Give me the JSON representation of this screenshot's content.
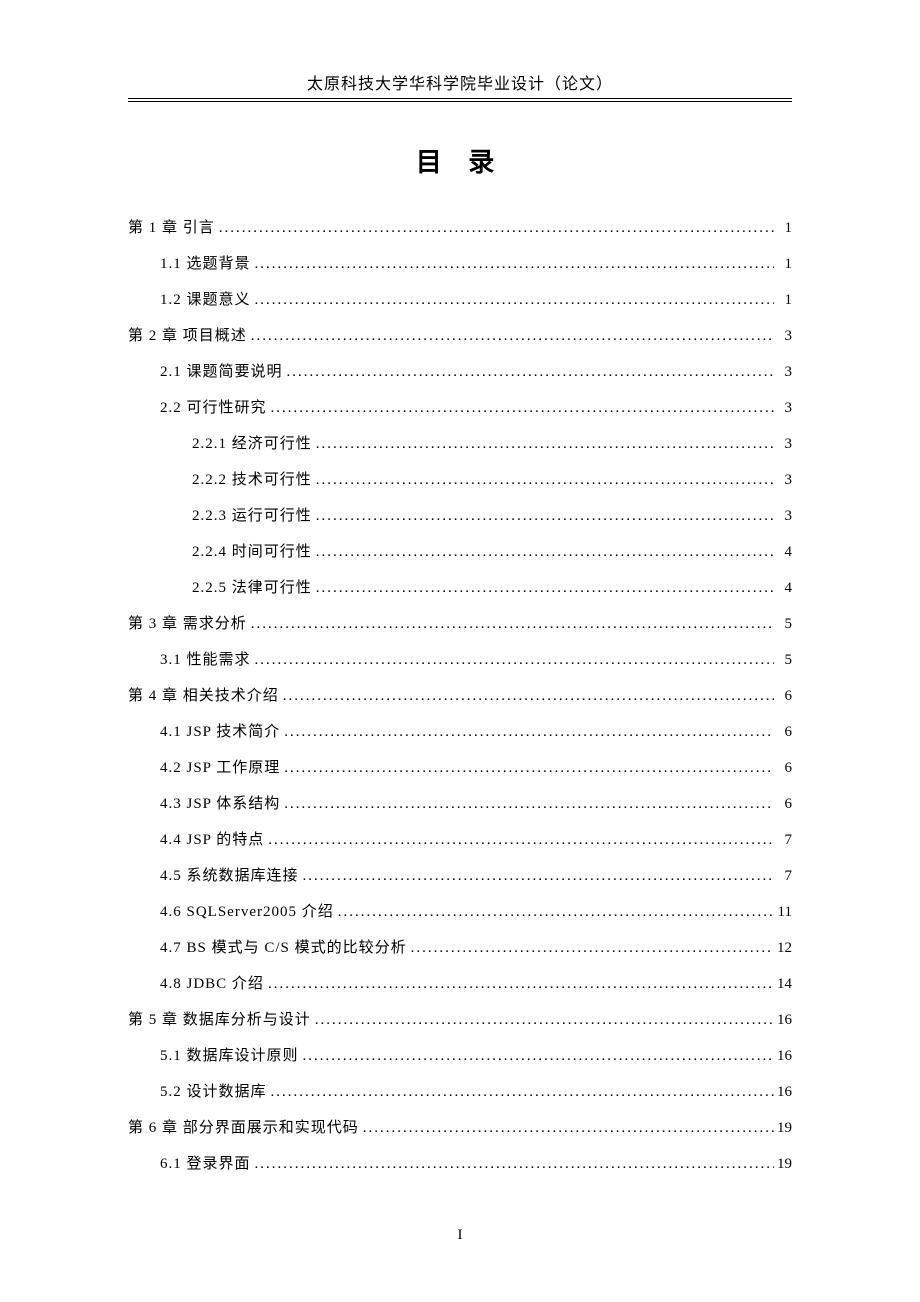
{
  "header": "太原科技大学华科学院毕业设计（论文）",
  "toc_title": "目 录",
  "page_number": "I",
  "entries": [
    {
      "level": 0,
      "label": "第 1 章  引言",
      "page": "1"
    },
    {
      "level": 1,
      "label": "1.1 选题背景",
      "page": "1"
    },
    {
      "level": 1,
      "label": "1.2 课题意义",
      "page": "1"
    },
    {
      "level": 0,
      "label": "第 2 章  项目概述",
      "page": "3"
    },
    {
      "level": 1,
      "label": "2.1  课题简要说明",
      "page": "3"
    },
    {
      "level": 1,
      "label": "2.2  可行性研究",
      "page": "3"
    },
    {
      "level": 2,
      "label": "2.2.1 经济可行性",
      "page": "3"
    },
    {
      "level": 2,
      "label": "2.2.2 技术可行性",
      "page": "3"
    },
    {
      "level": 2,
      "label": "2.2.3 运行可行性",
      "page": "3"
    },
    {
      "level": 2,
      "label": "2.2.4 时间可行性",
      "page": "4"
    },
    {
      "level": 2,
      "label": "2.2.5 法律可行性",
      "page": "4"
    },
    {
      "level": 0,
      "label": "第 3 章  需求分析",
      "page": "5"
    },
    {
      "level": 1,
      "label": "3.1  性能需求",
      "page": "5"
    },
    {
      "level": 0,
      "label": "第 4 章  相关技术介绍",
      "page": "6"
    },
    {
      "level": 1,
      "label": "4.1  JSP 技术简介",
      "page": "6"
    },
    {
      "level": 1,
      "label": "4.2  JSP 工作原理",
      "page": "6"
    },
    {
      "level": 1,
      "label": "4.3  JSP 体系结构",
      "page": "6"
    },
    {
      "level": 1,
      "label": "4.4  JSP 的特点",
      "page": "7"
    },
    {
      "level": 1,
      "label": "4.5  系统数据库连接",
      "page": "7"
    },
    {
      "level": 1,
      "label": "4.6  SQLServer2005 介绍",
      "page": "11"
    },
    {
      "level": 1,
      "label": "4.7  BS 模式与 C/S 模式的比较分析",
      "page": "12"
    },
    {
      "level": 1,
      "label": "4.8  JDBC 介绍",
      "page": "14"
    },
    {
      "level": 0,
      "label": "第 5 章  数据库分析与设计",
      "page": "16"
    },
    {
      "level": 1,
      "label": "5.1   数据库设计原则",
      "page": "16"
    },
    {
      "level": 1,
      "label": "5.2   设计数据库",
      "page": "16"
    },
    {
      "level": 0,
      "label": "第 6 章  部分界面展示和实现代码",
      "page": "19"
    },
    {
      "level": 1,
      "label": "6.1 登录界面",
      "page": "19"
    }
  ]
}
